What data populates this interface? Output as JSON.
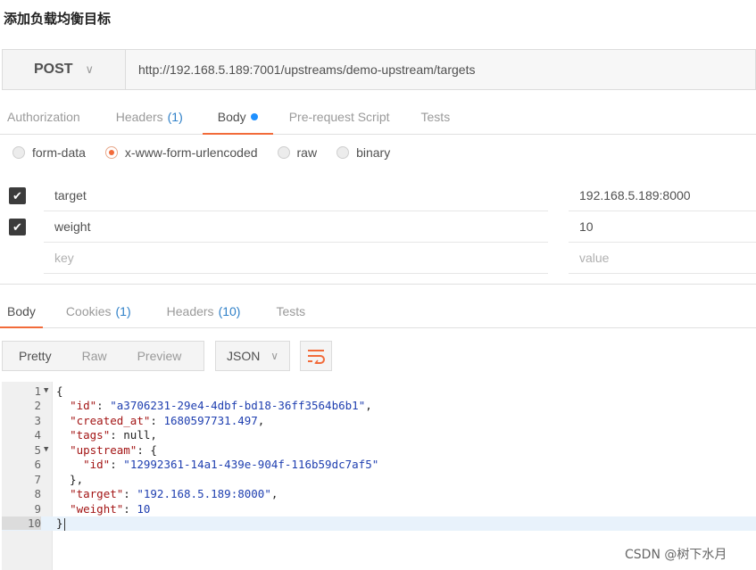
{
  "page_title": "添加负载均衡目标",
  "request": {
    "method": "POST",
    "url": "http://192.168.5.189:7001/upstreams/demo-upstream/targets"
  },
  "request_tabs": [
    {
      "label": "Authorization",
      "count": ""
    },
    {
      "label": "Headers",
      "count": "(1)"
    },
    {
      "label": "Body",
      "count": ""
    },
    {
      "label": "Pre-request Script",
      "count": ""
    },
    {
      "label": "Tests",
      "count": ""
    }
  ],
  "body_types": [
    "form-data",
    "x-www-form-urlencoded",
    "raw",
    "binary"
  ],
  "body_type_selected": "x-www-form-urlencoded",
  "params": [
    {
      "key": "target",
      "value": "192.168.5.189:8000",
      "checked": true
    },
    {
      "key": "weight",
      "value": "10",
      "checked": true
    }
  ],
  "params_placeholder": {
    "key": "key",
    "value": "value"
  },
  "response_tabs": [
    {
      "label": "Body",
      "count": ""
    },
    {
      "label": "Cookies",
      "count": "(1)"
    },
    {
      "label": "Headers",
      "count": "(10)"
    },
    {
      "label": "Tests",
      "count": ""
    }
  ],
  "view_modes": [
    "Pretty",
    "Raw",
    "Preview"
  ],
  "format": "JSON",
  "code_lines": [
    "1",
    "2",
    "3",
    "4",
    "5",
    "6",
    "7",
    "8",
    "9",
    "10"
  ],
  "response_json": {
    "id": "a3706231-29e4-4dbf-bd18-36ff3564b6b1",
    "created_at": "1680597731.497",
    "tags": "null",
    "upstream_id": "12992361-14a1-439e-904f-116b59dc7af5",
    "target": "192.168.5.189:8000",
    "weight": "10"
  },
  "watermark": "CSDN @树下水月",
  "colors": {
    "accent": "#f26b3a",
    "link": "#2f80c8",
    "dot": "#1e90ff"
  }
}
